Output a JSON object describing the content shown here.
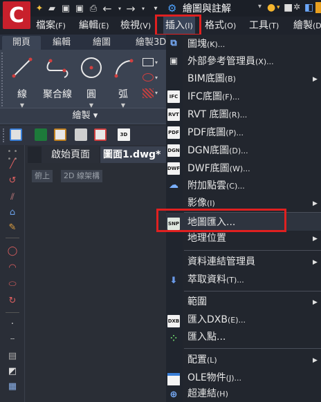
{
  "titlebar": {
    "workspace": "繪圖與註解",
    "logo_letter": "C"
  },
  "menubar": {
    "items": [
      {
        "label": "檔案",
        "key": "(F)"
      },
      {
        "label": "編輯",
        "key": "(E)"
      },
      {
        "label": "檢視",
        "key": "(V)"
      },
      {
        "label": "插入",
        "key": "(I)"
      },
      {
        "label": "格式",
        "key": "(O)"
      },
      {
        "label": "工具",
        "key": "(T)"
      },
      {
        "label": "繪製",
        "key": "(D"
      }
    ]
  },
  "ribbon": {
    "tabs": [
      "開頁",
      "編輯",
      "繪圖",
      "繪製3D"
    ],
    "tools": [
      "線",
      "聚合線",
      "圓",
      "弧"
    ],
    "panel_title": "繪製 ▾"
  },
  "doc_tabs": {
    "start": "啟始頁面",
    "drawing": "圖面1.dwg*"
  },
  "view_controls": [
    "俯上",
    "2D 線架構"
  ],
  "insert_menu": [
    {
      "label": "圖塊",
      "key": "(K)...",
      "icon": "block-icon",
      "arrow": false
    },
    {
      "label": "外部參考管理員",
      "key": "(X)...",
      "icon": "xref-icon",
      "arrow": false
    },
    {
      "label": "BIM底圖",
      "key": "(B)",
      "icon": "",
      "arrow": true
    },
    {
      "label": "IFC底圖",
      "key": "(F)...",
      "icon": "ifc-icon",
      "arrow": false
    },
    {
      "label": "RVT 底圖",
      "key": "(R)...",
      "icon": "rvt-icon",
      "arrow": false
    },
    {
      "label": "PDF底圖",
      "key": "(P)...",
      "icon": "pdf-icon",
      "arrow": false
    },
    {
      "label": "DGN底圖",
      "key": "(D)...",
      "icon": "dgn-icon",
      "arrow": false
    },
    {
      "label": "DWF底圖",
      "key": "(W)...",
      "icon": "dwf-icon",
      "arrow": false
    },
    {
      "label": "附加點雲",
      "key": "(C)...",
      "icon": "pointcloud-icon",
      "arrow": false
    },
    {
      "label": "影像",
      "key": "(I)",
      "icon": "",
      "arrow": true
    },
    {
      "label": "地圖匯入...",
      "key": "",
      "icon": "snp-icon",
      "arrow": false
    },
    {
      "label": "地理位置",
      "key": "",
      "icon": "",
      "arrow": true
    },
    {
      "label": "資料連結管理員",
      "key": "",
      "icon": "",
      "arrow": true
    },
    {
      "label": "萃取資料",
      "key": "(T)...",
      "icon": "extract-icon",
      "arrow": false
    },
    {
      "label": "範圍",
      "key": "",
      "icon": "",
      "arrow": true
    },
    {
      "label": "匯入DXB",
      "key": "(E)...",
      "icon": "dxb-icon",
      "arrow": false
    },
    {
      "label": "匯入點...",
      "key": "",
      "icon": "import-points-icon",
      "arrow": false
    },
    {
      "label": "配置",
      "key": "(L)",
      "icon": "",
      "arrow": true
    },
    {
      "label": "OLE物件",
      "key": "(J)...",
      "icon": "ole-icon",
      "arrow": false
    },
    {
      "label": "超連結",
      "key": "(H)",
      "icon": "hyperlink-icon",
      "arrow": false
    }
  ],
  "icon_text": {
    "ifc": "IFC",
    "rvt": "RVT",
    "pdf": "PDF",
    "dgn": "DGN",
    "dwf": "DWF",
    "snp": "SNP",
    "dxb": "DXB",
    "3d": "3D"
  },
  "colors": {
    "highlight_box": "#e02020",
    "logo": "#c8202c",
    "menu_bg": "#22262e"
  }
}
